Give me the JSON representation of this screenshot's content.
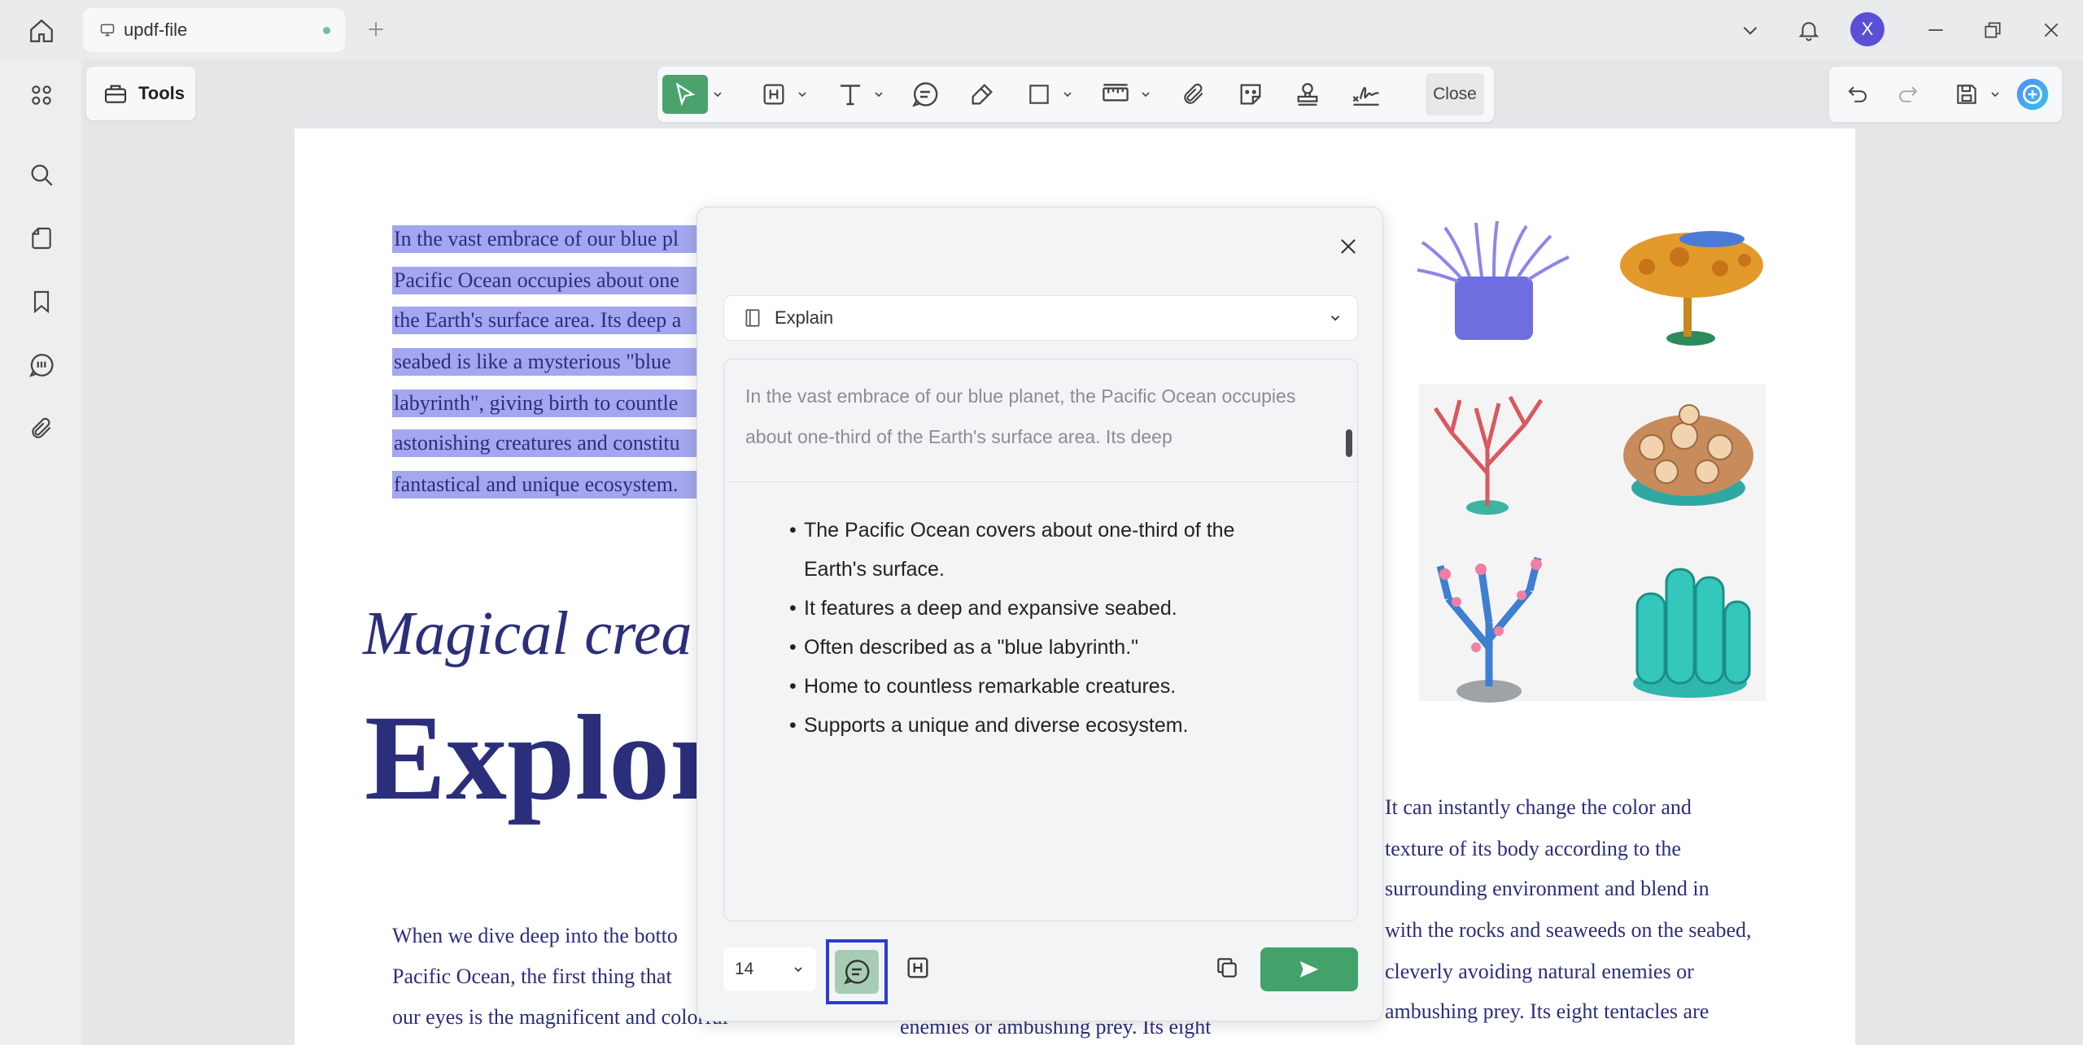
{
  "tab": {
    "title": "updf-file"
  },
  "user": {
    "avatar_initial": "X"
  },
  "tools": {
    "label": "Tools"
  },
  "toolbar": {
    "close_label": "Close"
  },
  "document": {
    "highlighted_lines": [
      "In the vast embrace of our blue pl",
      "Pacific Ocean occupies about one",
      "the Earth's surface area. Its deep a",
      "seabed is like a mysterious \"blue",
      "labyrinth\", giving birth to countle",
      "astonishing creatures and constitu",
      "fantastical and unique ecosystem."
    ],
    "heading_italic": "Magical crea",
    "heading_bold": "Explor",
    "left_body": [
      "When we dive deep into the botto",
      "Pacific Ocean, the first thing that",
      "our eyes is the magnificent and colorful"
    ],
    "middle_body": "enemies or ambushing prey. Its eight",
    "right_body": [
      "It can instantly change the color and",
      "texture of its body according to the",
      "surrounding environment and blend in",
      "with the rocks and seaweeds on the seabed,",
      "cleverly avoiding natural enemies or",
      "ambushing prey. Its eight tentacles are"
    ]
  },
  "dialog": {
    "mode": "Explain",
    "quote": "In the vast embrace of our blue planet, the Pacific Ocean occupies about one-third of the Earth's surface area. Its deep",
    "bullets": [
      "The Pacific Ocean covers about one-third of the Earth's surface.",
      "It features a deep and expansive seabed.",
      "Often described as a \"blue labyrinth.\"",
      "Home to countless remarkable creatures.",
      "Supports a unique and diverse ecosystem."
    ],
    "font_size": "14"
  },
  "colors": {
    "accent_green": "#4aa36d",
    "highlight": "#a4a6ef",
    "doc_text": "#2b2e7a",
    "focus_border": "#2b3bd0"
  }
}
